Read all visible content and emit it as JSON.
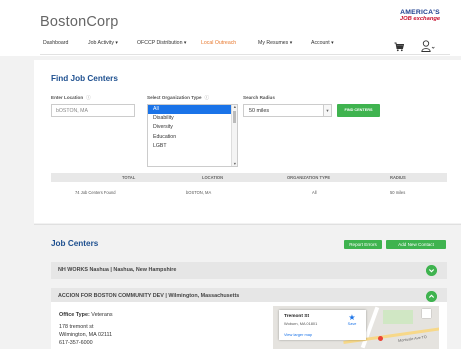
{
  "brand": "BostonCorp",
  "logo": {
    "line1": "AMERICA'S",
    "line2": "JOB exchange"
  },
  "nav": {
    "items": [
      {
        "label": "Dashboard"
      },
      {
        "label": "Job Activity ▾"
      },
      {
        "label": "OFCCP Distribution ▾"
      },
      {
        "label": "Local Outreach"
      },
      {
        "label": "My Resumes ▾"
      },
      {
        "label": "Account ▾"
      }
    ],
    "active_index": 3
  },
  "find": {
    "title": "Find Job Centers",
    "location_label": "Enter Location",
    "location_value": "bOSTON, MA",
    "org_label": "Select Organization Type",
    "org_options": [
      "All",
      "Disability",
      "Diversity",
      "Education",
      "LGBT"
    ],
    "org_selected": "All",
    "radius_label": "Search Radius",
    "radius_value": "50 miles",
    "button": "FIND CENTERS",
    "help_glyph": "ⓘ"
  },
  "summary": {
    "headers": [
      "TOTAL",
      "LOCATION",
      "ORGANIZATION TYPE",
      "RADIUS"
    ],
    "row": [
      "74 Job Centers Found",
      "bOSTON, MA",
      "All",
      "50 miles"
    ]
  },
  "results": {
    "title": "Job Centers",
    "report_errors": "Report Errors",
    "add_contact": "Add New Contact",
    "centers": [
      {
        "name": "NH WORKS Nashua | Nashua, New Hampshire",
        "expanded": false
      },
      {
        "name": "ACCION FOR BOSTON COMMUNITY DEV | Wilmington, Massachusetts",
        "expanded": true
      }
    ],
    "detail": {
      "office_type_label": "Office Type:",
      "office_type_value": "Veterans",
      "address_line1": "178 tremont st",
      "address_line2": "Wilmington, MA 02111",
      "phone": "617-357-6000"
    },
    "map": {
      "place": "Tremont St",
      "city": "Woburn, MA 01801",
      "link": "View larger map",
      "save": "Save",
      "street": "Montvale Ave  TO"
    }
  },
  "colors": {
    "accent_blue": "#1d4f8f",
    "green": "#3fb34f",
    "orange_active": "#e8792f"
  }
}
